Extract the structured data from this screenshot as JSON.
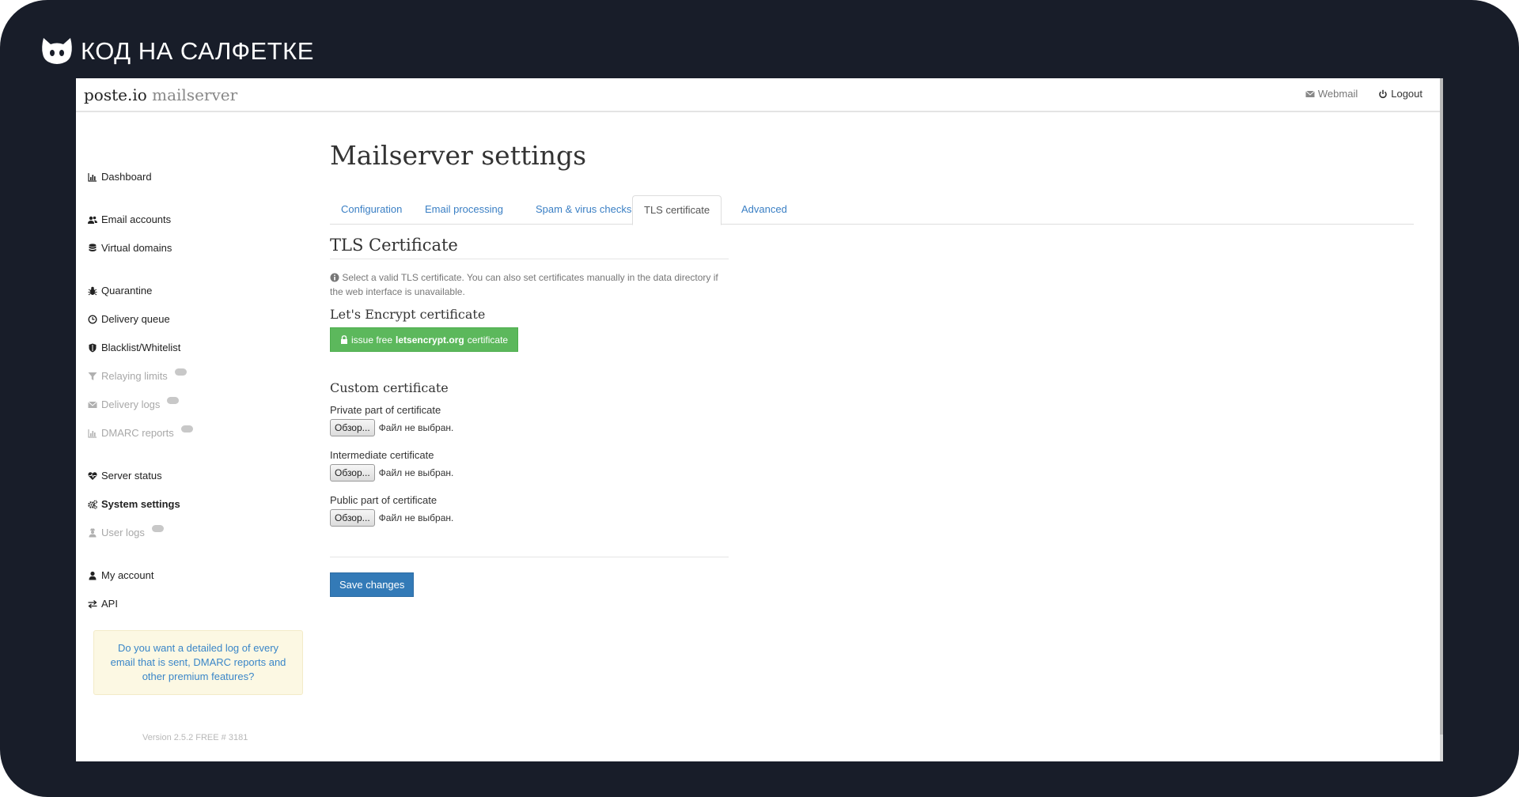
{
  "brand": {
    "title": "КОД НА САЛФЕТКЕ"
  },
  "app": {
    "logo_main": "poste.io",
    "logo_sub": "mailserver"
  },
  "topnav": {
    "webmail": "Webmail",
    "logout": "Logout"
  },
  "sidebar": {
    "items": [
      {
        "label": "Dashboard",
        "icon": "bar-chart-icon",
        "disabled": false
      },
      {
        "label": "Email accounts",
        "icon": "users-icon",
        "disabled": false
      },
      {
        "label": "Virtual domains",
        "icon": "database-icon",
        "disabled": false
      },
      {
        "label": "Quarantine",
        "icon": "bug-icon",
        "disabled": false
      },
      {
        "label": "Delivery queue",
        "icon": "clock-icon",
        "disabled": false
      },
      {
        "label": "Blacklist/Whitelist",
        "icon": "shield-icon",
        "disabled": false
      },
      {
        "label": "Relaying limits",
        "icon": "filter-icon",
        "disabled": true
      },
      {
        "label": "Delivery logs",
        "icon": "envelope-icon",
        "disabled": true
      },
      {
        "label": "DMARC reports",
        "icon": "bar-chart-icon",
        "disabled": true
      },
      {
        "label": "Server status",
        "icon": "heartbeat-icon",
        "disabled": false
      },
      {
        "label": "System settings",
        "icon": "cogs-icon",
        "disabled": false,
        "active": true
      },
      {
        "label": "User logs",
        "icon": "user-secret-icon",
        "disabled": true
      },
      {
        "label": "My account",
        "icon": "user-icon",
        "disabled": false
      },
      {
        "label": "API",
        "icon": "exchange-icon",
        "disabled": false
      }
    ],
    "promo": "Do you want a detailed log of every email that is sent, DMARC reports and other premium features?",
    "version": "Version 2.5.2 FREE # 3181"
  },
  "main": {
    "title": "Mailserver settings",
    "tabs": [
      {
        "label": "Configuration",
        "active": false
      },
      {
        "label": "Email processing",
        "active": false
      },
      {
        "label": "Spam & virus checks",
        "active": false
      },
      {
        "label": "TLS certificate",
        "active": true
      },
      {
        "label": "Advanced",
        "active": false
      }
    ],
    "section_title": "TLS Certificate",
    "help_text": "Select a valid TLS certificate. You can also set certificates manually in the data directory if the web interface is unavailable.",
    "letsencrypt": {
      "title": "Let's Encrypt certificate",
      "button_prefix": "issue free",
      "button_bold": "letsencrypt.org",
      "button_suffix": "certificate"
    },
    "custom": {
      "title": "Custom certificate",
      "fields": [
        {
          "label": "Private part of certificate",
          "button": "Обзор...",
          "status": "Файл не выбран."
        },
        {
          "label": "Intermediate certificate",
          "button": "Обзор...",
          "status": "Файл не выбран."
        },
        {
          "label": "Public part of certificate",
          "button": "Обзор...",
          "status": "Файл не выбран."
        }
      ]
    },
    "save_label": "Save changes"
  },
  "colors": {
    "accent": "#337ab7",
    "success": "#5cb85c",
    "link": "#3a7fc4",
    "frame": "#181d29",
    "promo_bg": "#fcf8e3"
  }
}
